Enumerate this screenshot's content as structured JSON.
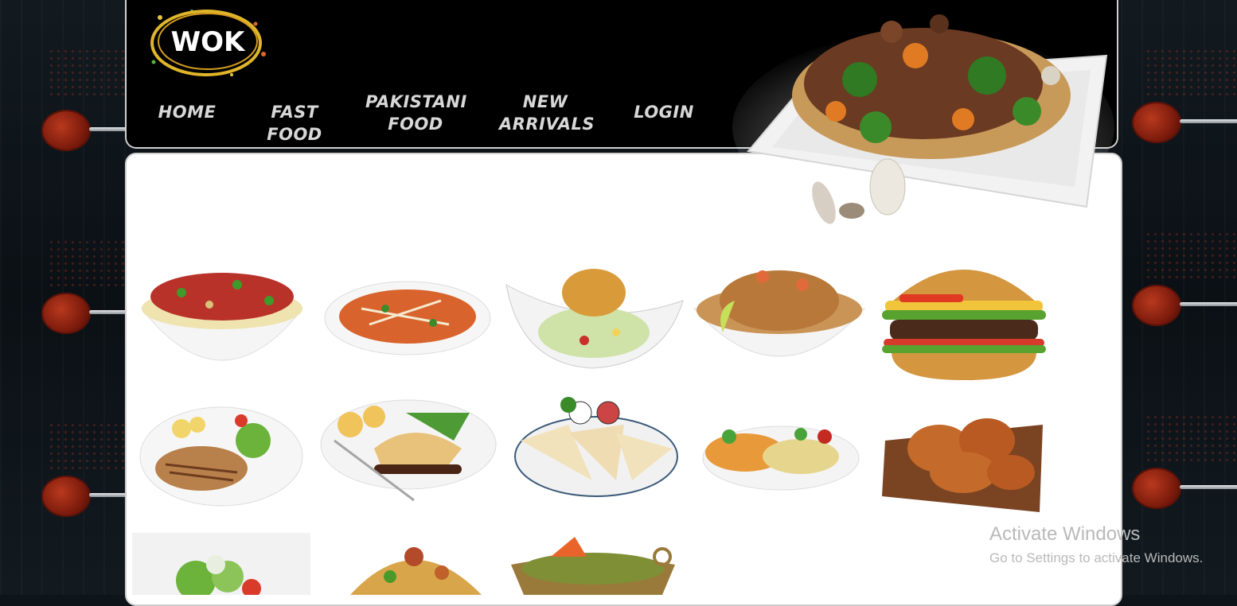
{
  "logo": {
    "text": "WOK"
  },
  "nav": {
    "items": [
      {
        "label": "HOME"
      },
      {
        "label_line1": "FAST FOOD"
      },
      {
        "label_line1": "PAKISTANI",
        "label_line2": "FOOD"
      },
      {
        "label_line1": "NEW",
        "label_line2": "ARRIVALS"
      },
      {
        "label": "LOGIN"
      }
    ]
  },
  "colors": {
    "header_bg": "#000000",
    "nav_text": "#d8d8d8",
    "page_bg": "#0e1419",
    "content_bg": "#ffffff"
  },
  "menu_items": [
    {
      "name": "chili-chicken-noodle-bowl"
    },
    {
      "name": "penne-pasta-plate"
    },
    {
      "name": "fried-shrimp-salad"
    },
    {
      "name": "shrimp-noodles"
    },
    {
      "name": "burger"
    },
    {
      "name": "grilled-chicken-plate"
    },
    {
      "name": "steak-pie-plate"
    },
    {
      "name": "quesadilla-plate"
    },
    {
      "name": "fried-rice-plate"
    },
    {
      "name": "fried-chicken-board"
    },
    {
      "name": "salad-bowl"
    },
    {
      "name": "biryani"
    },
    {
      "name": "saag-karahi"
    }
  ],
  "watermark": {
    "title": "Activate Windows",
    "subtitle": "Go to Settings to activate Windows."
  }
}
